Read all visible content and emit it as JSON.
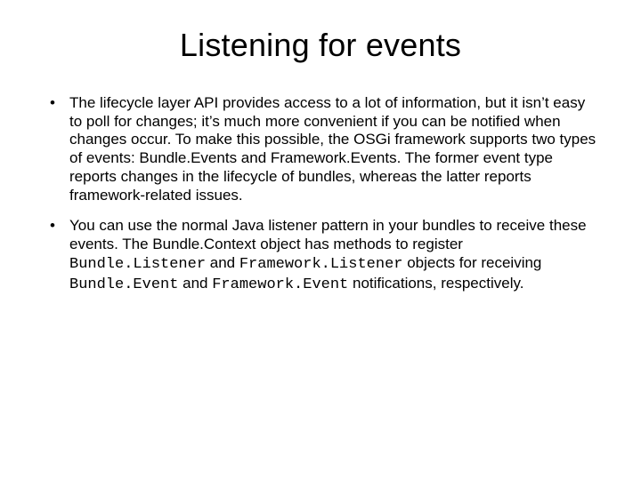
{
  "title": "Listening for events",
  "bullets": [
    {
      "text": "The lifecycle layer API provides access to a lot of information, but it isn’t easy to poll for changes; it’s much more convenient if you can be notified when changes occur. To make this possible, the OSGi framework supports two types of events: Bundle.Events and Framework.Events. The former event type reports changes in the lifecycle of bundles, whereas the latter reports framework-related issues."
    },
    {
      "prefix": "You can use the normal Java listener pattern in your bundles to receive these events. The Bundle.Context object has methods to register ",
      "code1": "Bundle.Listener",
      "mid1": " and ",
      "code2": "Framework.Listener",
      "mid2": " objects for receiving ",
      "code3": "Bundle.Event",
      "mid3": " and ",
      "code4": "Framework.Event",
      "suffix": " notifications, respectively."
    }
  ]
}
